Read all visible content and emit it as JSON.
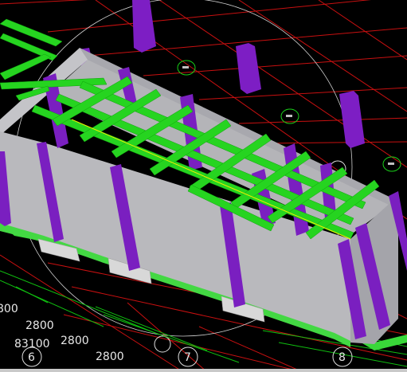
{
  "viewport": {
    "background": "#000000",
    "colors": {
      "wall": "#b9b9bd",
      "wall_dark": "#9a9aa0",
      "column": "#7a1fc0",
      "beam": "#22d21c",
      "grid_red": "#d01010",
      "grid_green": "#10c810",
      "axis_circle": "#d8d8d8"
    },
    "dimension_labels": [
      "800",
      "2800",
      "83100",
      "2800",
      "2800"
    ],
    "axis_labels": [
      "6",
      "7",
      "8"
    ]
  }
}
